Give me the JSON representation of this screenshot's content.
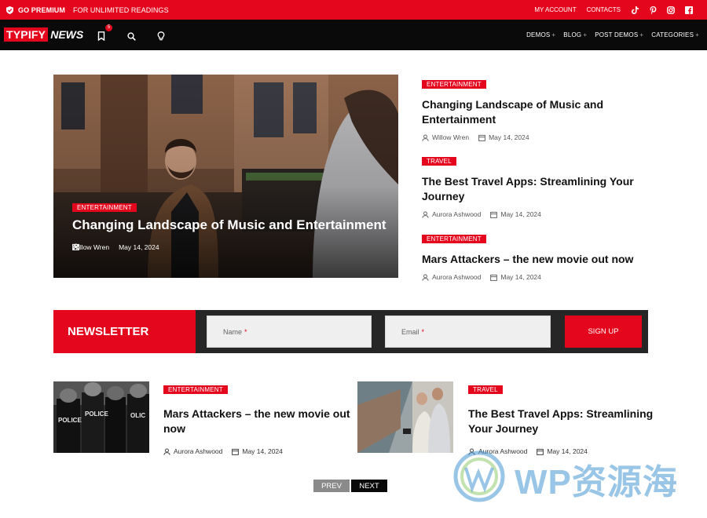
{
  "promo": {
    "brand": "GO PREMIUM",
    "sub": "FOR UNLIMITED READINGS",
    "links": [
      "MY ACCOUNT",
      "CONTACTS"
    ],
    "social": [
      "tiktok-icon",
      "pinterest-icon",
      "instagram-icon",
      "facebook-icon"
    ]
  },
  "nav": {
    "logo_a": "TYPIFY",
    "logo_b": "NEWS",
    "bookmark_count": "5",
    "menu": [
      "DEMOS",
      "BLOG",
      "POST DEMOS",
      "CATEGORIES"
    ]
  },
  "hero": {
    "tag": "ENTERTAINMENT",
    "title": "Changing Landscape of Music and Entertainment",
    "author": "Willow Wren",
    "date": "May 14, 2024"
  },
  "side": [
    {
      "tag": "ENTERTAINMENT",
      "title": "Changing Landscape of Music and Entertainment",
      "author": "Willow Wren",
      "date": "May 14, 2024"
    },
    {
      "tag": "TRAVEL",
      "title": "The Best Travel Apps: Streamlining Your Journey",
      "author": "Aurora Ashwood",
      "date": "May 14, 2024"
    },
    {
      "tag": "ENTERTAINMENT",
      "title": "Mars Attackers – the new movie out now",
      "author": "Aurora Ashwood",
      "date": "May 14, 2024"
    }
  ],
  "newsletter": {
    "label": "NEWSLETTER",
    "name_placeholder": "Name",
    "email_placeholder": "Email",
    "required_mark": "*",
    "button": "SIGN UP"
  },
  "cards": [
    {
      "tag": "ENTERTAINMENT",
      "title": "Mars Attackers – the new movie out now",
      "author": "Aurora Ashwood",
      "date": "May 14, 2024"
    },
    {
      "tag": "TRAVEL",
      "title": "The Best Travel Apps: Streamlining Your Journey",
      "author": "Aurora Ashwood",
      "date": "May 14, 2024"
    }
  ],
  "pager": {
    "prev": "PREV",
    "next": "NEXT"
  },
  "watermark": {
    "text": "WP资源海"
  },
  "colors": {
    "accent": "#e3061d",
    "dark": "#0a0a0a",
    "newsletter_bg": "#262626"
  }
}
